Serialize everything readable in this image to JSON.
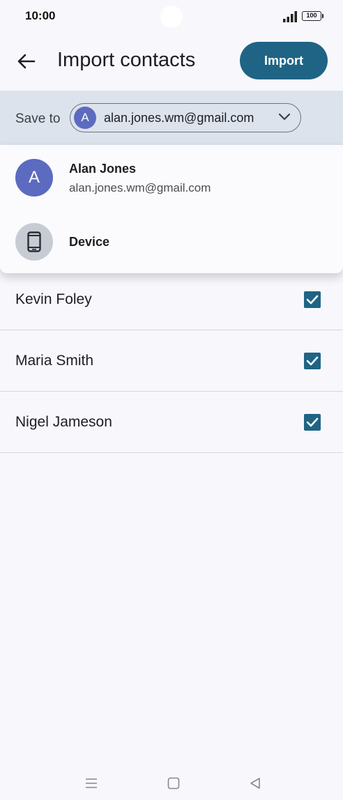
{
  "status_bar": {
    "time": "10:00",
    "battery": "100"
  },
  "app_bar": {
    "title": "Import contacts",
    "import_label": "Import"
  },
  "save_to": {
    "label": "Save to",
    "avatar_letter": "A",
    "selected_account": "alan.jones.wm@gmail.com"
  },
  "dropdown": {
    "items": [
      {
        "avatar_letter": "A",
        "name": "Alan Jones",
        "email": "alan.jones.wm@gmail.com"
      },
      {
        "name": "Device",
        "icon": "phone-icon"
      }
    ]
  },
  "contacts": [
    {
      "name": "Kevin Foley",
      "checked": true
    },
    {
      "name": "Maria Smith",
      "checked": true
    },
    {
      "name": "Nigel Jameson",
      "checked": true
    }
  ],
  "colors": {
    "accent": "#1f6484",
    "avatar": "#5c6bc0",
    "save_bar_bg": "#dde3ec",
    "page_bg": "#f8f8fc"
  }
}
